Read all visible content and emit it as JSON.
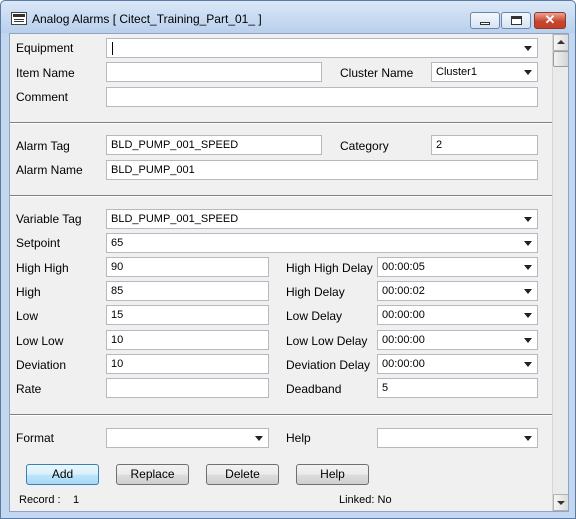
{
  "window": {
    "title": "Analog Alarms [ Citect_Training_Part_01_ ]",
    "close_glyph": "✕"
  },
  "general": {
    "equipment_label": "Equipment",
    "equipment_value": "",
    "item_name_label": "Item Name",
    "item_name_value": "",
    "cluster_name_label": "Cluster Name",
    "cluster_name_value": "Cluster1",
    "comment_label": "Comment",
    "comment_value": ""
  },
  "alarm": {
    "tag_label": "Alarm Tag",
    "tag_value": "BLD_PUMP_001_SPEED",
    "category_label": "Category",
    "category_value": "2",
    "name_label": "Alarm Name",
    "name_value": "BLD_PUMP_001"
  },
  "limits": {
    "variable_tag_label": "Variable Tag",
    "variable_tag_value": "BLD_PUMP_001_SPEED",
    "setpoint_label": "Setpoint",
    "setpoint_value": "65",
    "high_high_label": "High High",
    "high_high_value": "90",
    "high_high_delay_label": "High High Delay",
    "high_high_delay_value": "00:00:05",
    "high_label": "High",
    "high_value": "85",
    "high_delay_label": "High Delay",
    "high_delay_value": "00:00:02",
    "low_label": "Low",
    "low_value": "15",
    "low_delay_label": "Low Delay",
    "low_delay_value": "00:00:00",
    "low_low_label": "Low Low",
    "low_low_value": "10",
    "low_low_delay_label": "Low Low Delay",
    "low_low_delay_value": "00:00:00",
    "deviation_label": "Deviation",
    "deviation_value": "10",
    "deviation_delay_label": "Deviation Delay",
    "deviation_delay_value": "00:00:00",
    "rate_label": "Rate",
    "rate_value": "",
    "deadband_label": "Deadband",
    "deadband_value": "5"
  },
  "extra": {
    "format_label": "Format",
    "format_value": "",
    "help_label": "Help",
    "help_value": ""
  },
  "buttons": {
    "add": "Add",
    "replace": "Replace",
    "delete": "Delete",
    "help": "Help"
  },
  "status": {
    "record_label": "Record :",
    "record_value": "1",
    "linked_text": "Linked: No"
  },
  "icons": {
    "app": "form-icon",
    "dropdown": "chevron-down-icon"
  }
}
